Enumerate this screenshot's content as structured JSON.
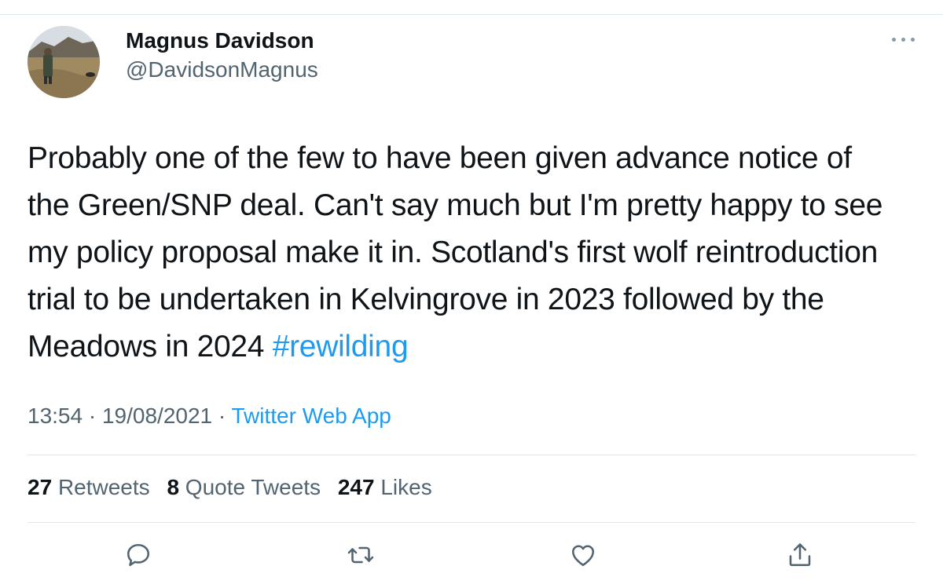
{
  "author": {
    "display_name": "Magnus Davidson",
    "handle": "@DavidsonMagnus",
    "avatar_icon": "profile-photo-landscape"
  },
  "tweet": {
    "text_lines": [
      "Probably one of the few to have been given advance notice of",
      "the Green/SNP deal. Can't say much but I'm pretty happy to see",
      "my policy proposal make it in. Scotland's first wolf reintroduction",
      "trial to be undertaken in Kelvingrove in 2023 followed by the",
      "Meadows in 2024 "
    ],
    "hashtag": "#rewilding"
  },
  "meta": {
    "time": "13:54",
    "separator": "·",
    "date": "19/08/2021",
    "source": "Twitter Web App"
  },
  "stats": {
    "retweets_count": "27",
    "retweets_label": "Retweets",
    "quotes_count": "8",
    "quotes_label": "Quote Tweets",
    "likes_count": "247",
    "likes_label": "Likes"
  },
  "actions": {
    "reply_icon": "reply-icon",
    "retweet_icon": "retweet-icon",
    "like_icon": "heart-icon",
    "share_icon": "share-icon"
  },
  "colors": {
    "accent": "#1d9bf0",
    "secondary_text": "#536471",
    "icon": "#536471",
    "divider": "#e1e8ed"
  }
}
